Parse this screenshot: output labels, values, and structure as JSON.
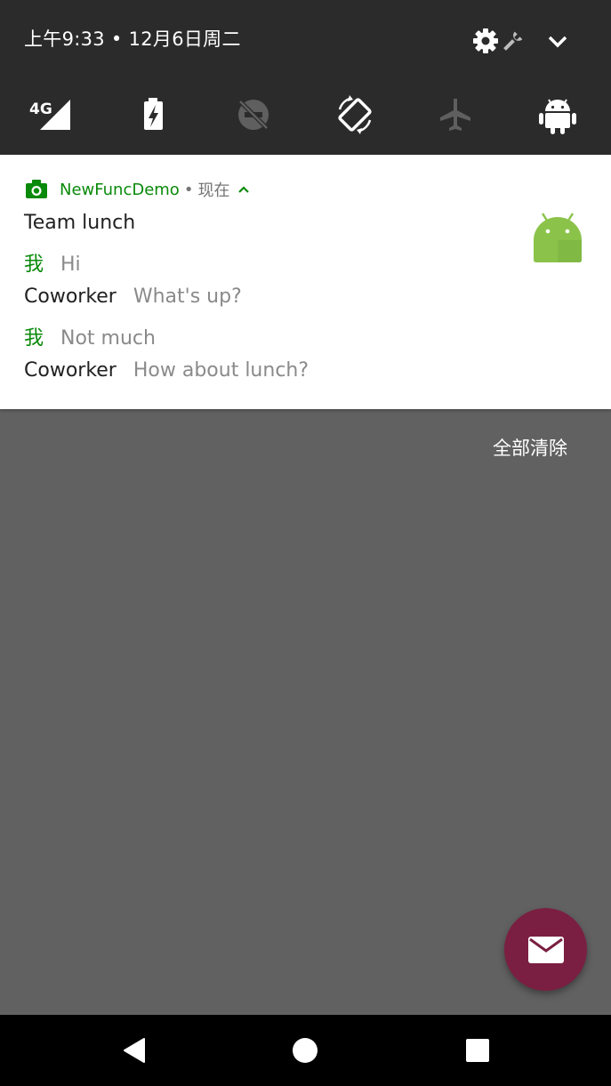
{
  "status": {
    "time_date": "上午9:33 • 12月6日周二",
    "tiles": [
      {
        "icon": "signal-4g-icon",
        "label": "4G"
      },
      {
        "icon": "battery-saver-icon"
      },
      {
        "icon": "do-not-disturb-off-icon"
      },
      {
        "icon": "auto-rotate-icon"
      },
      {
        "icon": "airplane-mode-icon"
      },
      {
        "icon": "android-icon"
      }
    ]
  },
  "notification": {
    "app_name": "NewFuncDemo",
    "dot": "•",
    "time": "现在",
    "title": "Team lunch",
    "messages": [
      {
        "sender": "我",
        "text": "Hi",
        "is_self": true
      },
      {
        "sender": "Coworker",
        "text": "What's up?",
        "is_self": false
      },
      {
        "sender": "我",
        "text": "Not much",
        "is_self": true
      },
      {
        "sender": "Coworker",
        "text": "How about lunch?",
        "is_self": false
      }
    ],
    "accent_color": "#0a8a0a"
  },
  "clear_all": "全部清除",
  "fab": {
    "icon": "email-icon",
    "color": "#7a1f41"
  },
  "colors": {
    "header_bg": "#2b2b2b",
    "scrim_bg": "#616161",
    "navbar_bg": "#000000"
  }
}
